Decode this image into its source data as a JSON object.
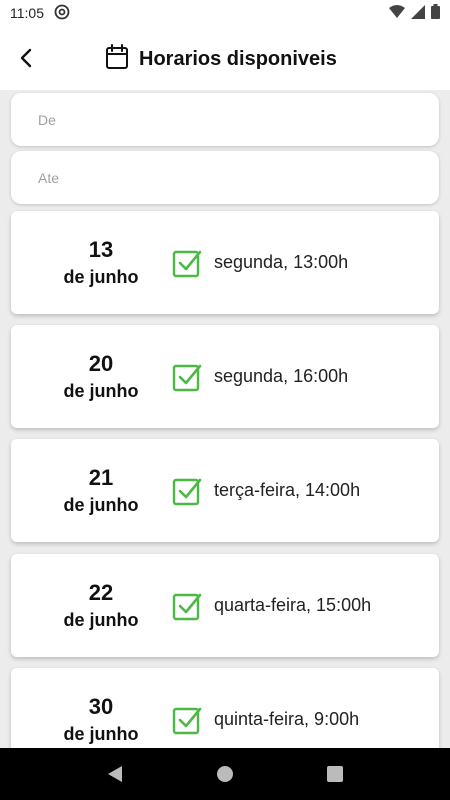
{
  "status_bar": {
    "time": "11:05",
    "icons": [
      "at-sign-icon",
      "wifi-icon",
      "signal-icon",
      "battery-icon"
    ]
  },
  "header": {
    "title": "Horarios disponiveis",
    "back_icon": "chevron-left-icon",
    "title_icon": "calendar-icon"
  },
  "filters": {
    "from": {
      "placeholder": "De",
      "value": ""
    },
    "to": {
      "placeholder": "Ate",
      "value": ""
    }
  },
  "slots": [
    {
      "day": "13",
      "month": "de junho",
      "when": "segunda, 13:00h",
      "checked": true
    },
    {
      "day": "20",
      "month": "de junho",
      "when": "segunda, 16:00h",
      "checked": true
    },
    {
      "day": "21",
      "month": "de junho",
      "when": "terça-feira, 14:00h",
      "checked": true
    },
    {
      "day": "22",
      "month": "de junho",
      "when": "quarta-feira, 15:00h",
      "checked": true
    },
    {
      "day": "30",
      "month": "de junho",
      "when": "quinta-feira, 9:00h",
      "checked": true
    }
  ],
  "nav_bar": {
    "buttons": [
      "back-triangle-icon",
      "home-circle-icon",
      "recents-square-icon"
    ]
  },
  "colors": {
    "check_green": "#4cb944",
    "background": "#ececec",
    "card": "#ffffff"
  }
}
